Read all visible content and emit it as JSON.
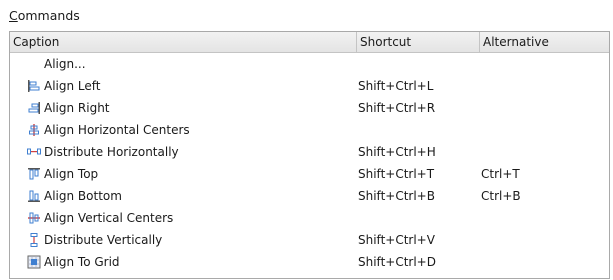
{
  "section": {
    "label": "Commands",
    "mnemonic": "C",
    "rest": "ommands"
  },
  "columns": [
    "Caption",
    "Shortcut",
    "Alternative"
  ],
  "rows": [
    {
      "caption": "Align...",
      "shortcut": "",
      "alternative": "",
      "icon": "none"
    },
    {
      "caption": "Align Left",
      "shortcut": "Shift+Ctrl+L",
      "alternative": "",
      "icon": "align-left-icon"
    },
    {
      "caption": "Align Right",
      "shortcut": "Shift+Ctrl+R",
      "alternative": "",
      "icon": "align-right-icon"
    },
    {
      "caption": "Align Horizontal Centers",
      "shortcut": "",
      "alternative": "",
      "icon": "align-horizontal-centers-icon"
    },
    {
      "caption": "Distribute Horizontally",
      "shortcut": "Shift+Ctrl+H",
      "alternative": "",
      "icon": "distribute-horizontally-icon"
    },
    {
      "caption": "Align Top",
      "shortcut": "Shift+Ctrl+T",
      "alternative": "Ctrl+T",
      "icon": "align-top-icon"
    },
    {
      "caption": "Align Bottom",
      "shortcut": "Shift+Ctrl+B",
      "alternative": "Ctrl+B",
      "icon": "align-bottom-icon"
    },
    {
      "caption": "Align Vertical Centers",
      "shortcut": "",
      "alternative": "",
      "icon": "align-vertical-centers-icon"
    },
    {
      "caption": "Distribute Vertically",
      "shortcut": "Shift+Ctrl+V",
      "alternative": "",
      "icon": "distribute-vertically-icon"
    },
    {
      "caption": "Align To Grid",
      "shortcut": "Shift+Ctrl+D",
      "alternative": "",
      "icon": "align-to-grid-icon"
    }
  ],
  "colors": {
    "icon_blue": "#3f7fd0",
    "icon_red": "#d04040",
    "header_border": "#c4c4c4",
    "grid_border": "#a9a9a9"
  }
}
